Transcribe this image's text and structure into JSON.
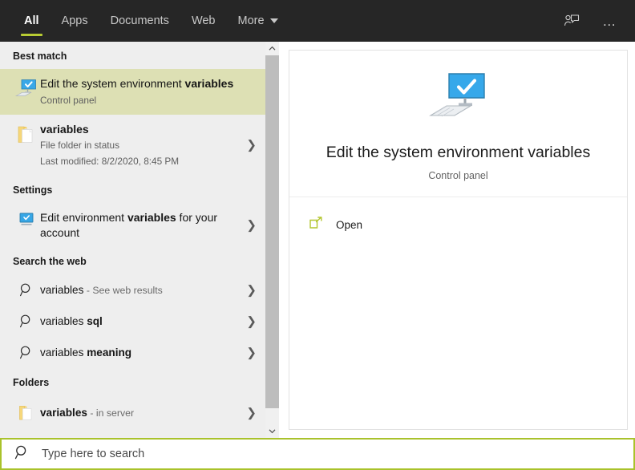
{
  "tabbar": {
    "tabs": [
      {
        "label": "All",
        "active": true
      },
      {
        "label": "Apps",
        "active": false
      },
      {
        "label": "Documents",
        "active": false
      },
      {
        "label": "Web",
        "active": false
      },
      {
        "label": "More",
        "active": false,
        "has_caret": true
      }
    ],
    "feedback_icon": "person-feedback-icon",
    "more_options": "…",
    "accent_color": "#b8cc33",
    "background_color": "#262626"
  },
  "results": {
    "sections": [
      {
        "heading": "Best match",
        "items": [
          {
            "icon": "monitor-check-icon",
            "title": "Edit the system environment variables",
            "title_bold_part": "variables",
            "subtitle": "Control panel",
            "highlighted": true,
            "chevron": false
          }
        ]
      },
      {
        "heading": "",
        "items": [
          {
            "icon": "folder-icon",
            "title": "variables",
            "title_bold_part": "variables",
            "subtitle": "File folder in status",
            "subtitle2": "Last modified: 8/2/2020, 8:45 PM",
            "highlighted": false,
            "chevron": true
          }
        ]
      },
      {
        "heading": "Settings",
        "items": [
          {
            "icon": "monitor-check-small-icon",
            "title": "Edit environment variables for your account",
            "title_bold_part": "variables",
            "subtitle": "",
            "highlighted": false,
            "chevron": true
          }
        ]
      },
      {
        "heading": "Search the web",
        "items": [
          {
            "icon": "search-icon",
            "title": "variables",
            "title_bold_part": "variables",
            "suffix": " - See web results",
            "highlighted": false,
            "chevron": true
          },
          {
            "icon": "search-icon",
            "title": "variables sql",
            "title_bold_part": "sql",
            "highlighted": false,
            "chevron": true
          },
          {
            "icon": "search-icon",
            "title": "variables meaning",
            "title_bold_part": "meaning",
            "highlighted": false,
            "chevron": true
          }
        ]
      },
      {
        "heading": "Folders",
        "items": [
          {
            "icon": "folder-icon",
            "title": "variables",
            "title_bold_part": "variables",
            "suffix": " - in server",
            "highlighted": false,
            "chevron": true
          }
        ]
      }
    ],
    "background_color": "#eeeeee",
    "highlight_color": "#dde0b4"
  },
  "preview": {
    "icon": "monitor-check-large-icon",
    "title": "Edit the system environment variables",
    "subtitle": "Control panel",
    "actions": [
      {
        "icon": "open-external-icon",
        "label": "Open"
      }
    ]
  },
  "search": {
    "placeholder": "Type here to search",
    "value": "",
    "icon": "search-icon",
    "border_color": "#a9c22b"
  }
}
